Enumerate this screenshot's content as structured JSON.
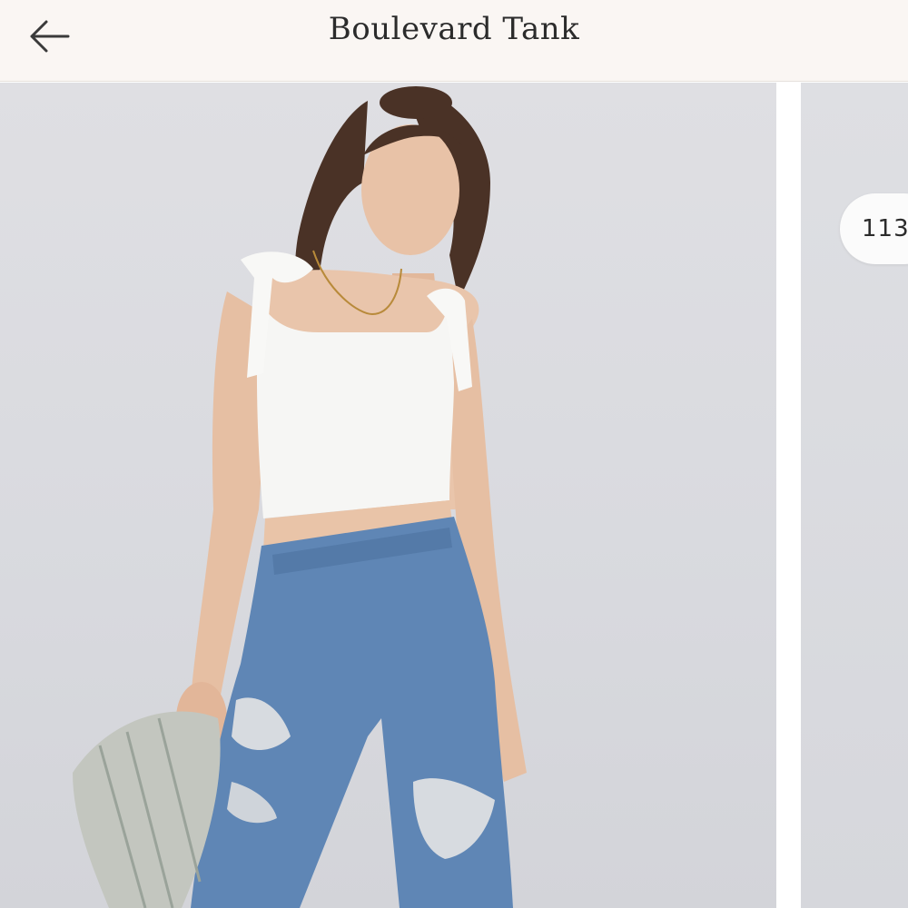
{
  "header": {
    "title": "Boulevard Tank",
    "back_icon": "arrow-left-icon"
  },
  "gallery": {
    "next_slide_counter": "113",
    "main_image_description_icon": "product-photo"
  },
  "colors": {
    "header_bg": "#faf6f3",
    "photo_bg": "#dcdde2",
    "text": "#2b2b2b"
  }
}
